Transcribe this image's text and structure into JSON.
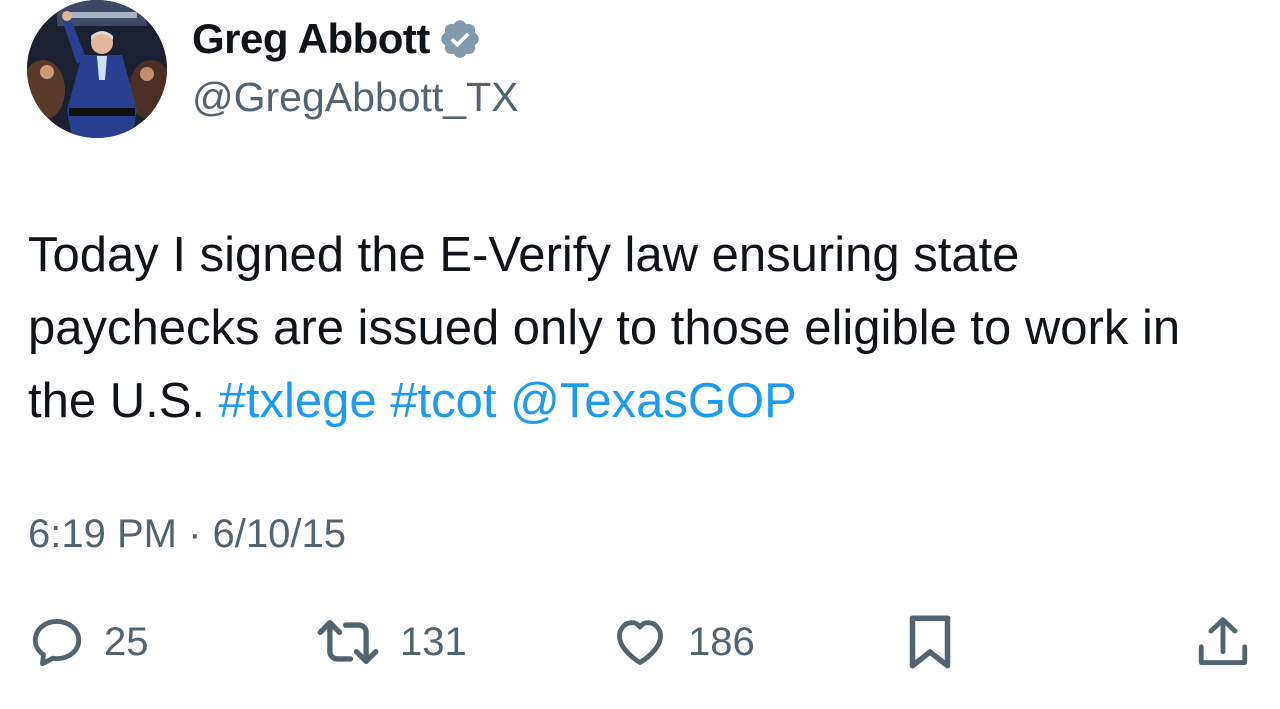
{
  "author": {
    "display_name": "Greg Abbott",
    "handle": "@GregAbbott_TX",
    "verified_badge_color": "#829aab"
  },
  "tweet": {
    "text_plain": "Today I signed the E-Verify law ensuring state paychecks are issued only to those eligible to work in the U.S. ",
    "hashtag_1": "#txlege",
    "hashtag_2": "#tcot",
    "mention": "@TexasGOP",
    "link_color": "#1d9bf0"
  },
  "meta": {
    "time": "6:19 PM",
    "separator": "·",
    "date": "6/10/15"
  },
  "actions": {
    "reply_count": "25",
    "retweet_count": "131",
    "like_count": "186"
  },
  "icons": {
    "reply": "reply-icon",
    "retweet": "retweet-icon",
    "like": "heart-icon",
    "bookmark": "bookmark-icon",
    "share": "share-icon",
    "verified": "verified-badge-icon"
  }
}
